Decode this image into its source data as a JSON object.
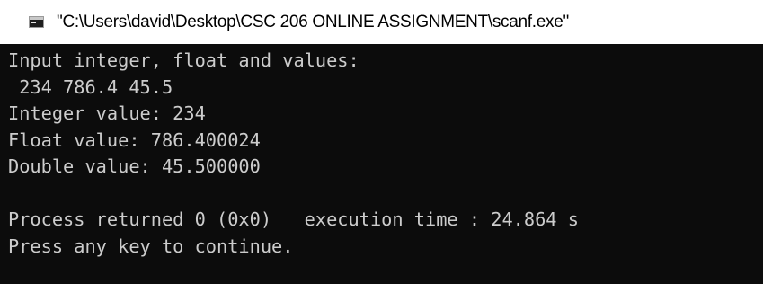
{
  "window": {
    "title": "\"C:\\Users\\david\\Desktop\\CSC 206 ONLINE ASSIGNMENT\\scanf.exe\"",
    "icon": "console-app-icon",
    "colors": {
      "titlebar_bg": "#ffffff",
      "console_bg": "#0c0c0c",
      "console_text": "#cccccc"
    }
  },
  "console": {
    "lines": [
      "Input integer, float and values:",
      " 234 786.4 45.5",
      "Integer value: 234",
      "Float value: 786.400024",
      "Double value: 45.500000",
      "",
      "Process returned 0 (0x0)   execution time : 24.864 s",
      "Press any key to continue."
    ]
  }
}
